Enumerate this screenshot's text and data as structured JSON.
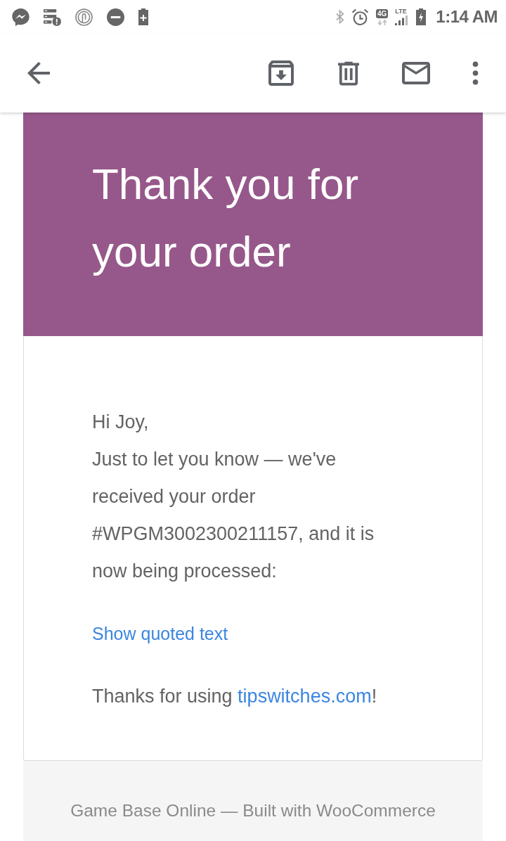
{
  "status_bar": {
    "network_type": "4G",
    "signal_label": "LTE",
    "time": "1:14 AM"
  },
  "email": {
    "header": {
      "title": "Thank you for your order"
    },
    "greeting": "Hi Joy,",
    "message": "Just to let you know — we've received your order #WPGM3002300211157, and it is now being processed:",
    "quoted_link": "Show quoted text",
    "thanks": {
      "before": "Thanks for using ",
      "link": "tipswitches.com",
      "after": "!"
    }
  },
  "footer": {
    "text": "Game Base Online — Built with WooCommerce"
  }
}
